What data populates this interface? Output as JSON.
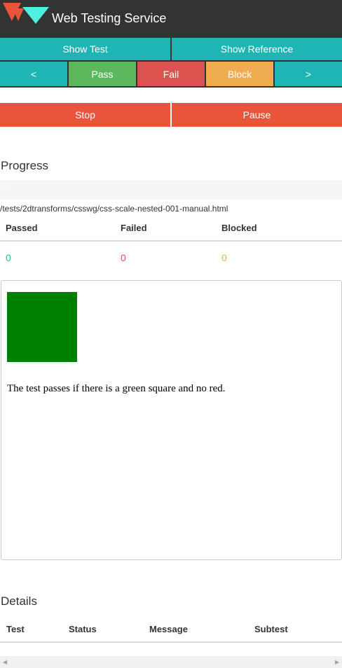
{
  "header": {
    "title": "Web Testing Service"
  },
  "toolbar": {
    "show_test": "Show Test",
    "show_reference": "Show Reference"
  },
  "nav": {
    "prev": "<",
    "pass": "Pass",
    "fail": "Fail",
    "block": "Block",
    "next": ">"
  },
  "controls": {
    "stop": "Stop",
    "pause": "Pause"
  },
  "progress": {
    "title": "Progress",
    "percent_label": "0%",
    "percent_value": 0,
    "test_path": "/tests/2dtransforms/csswg/css-scale-nested-001-manual.html"
  },
  "stats": {
    "headers": [
      "Passed",
      "Failed",
      "Blocked"
    ],
    "values": [
      "0",
      "0",
      "0"
    ]
  },
  "test": {
    "description": "The test passes if there is a green square and no red."
  },
  "details": {
    "title": "Details",
    "columns": [
      "Test",
      "Status",
      "Message",
      "Subtest"
    ]
  },
  "colors": {
    "teal": "#1fb5b5",
    "pass": "#5cb85c",
    "fail": "#d9534f",
    "block": "#f0ad4e",
    "stop": "#e8553b",
    "header_bg": "#333333",
    "square": "#008000"
  }
}
